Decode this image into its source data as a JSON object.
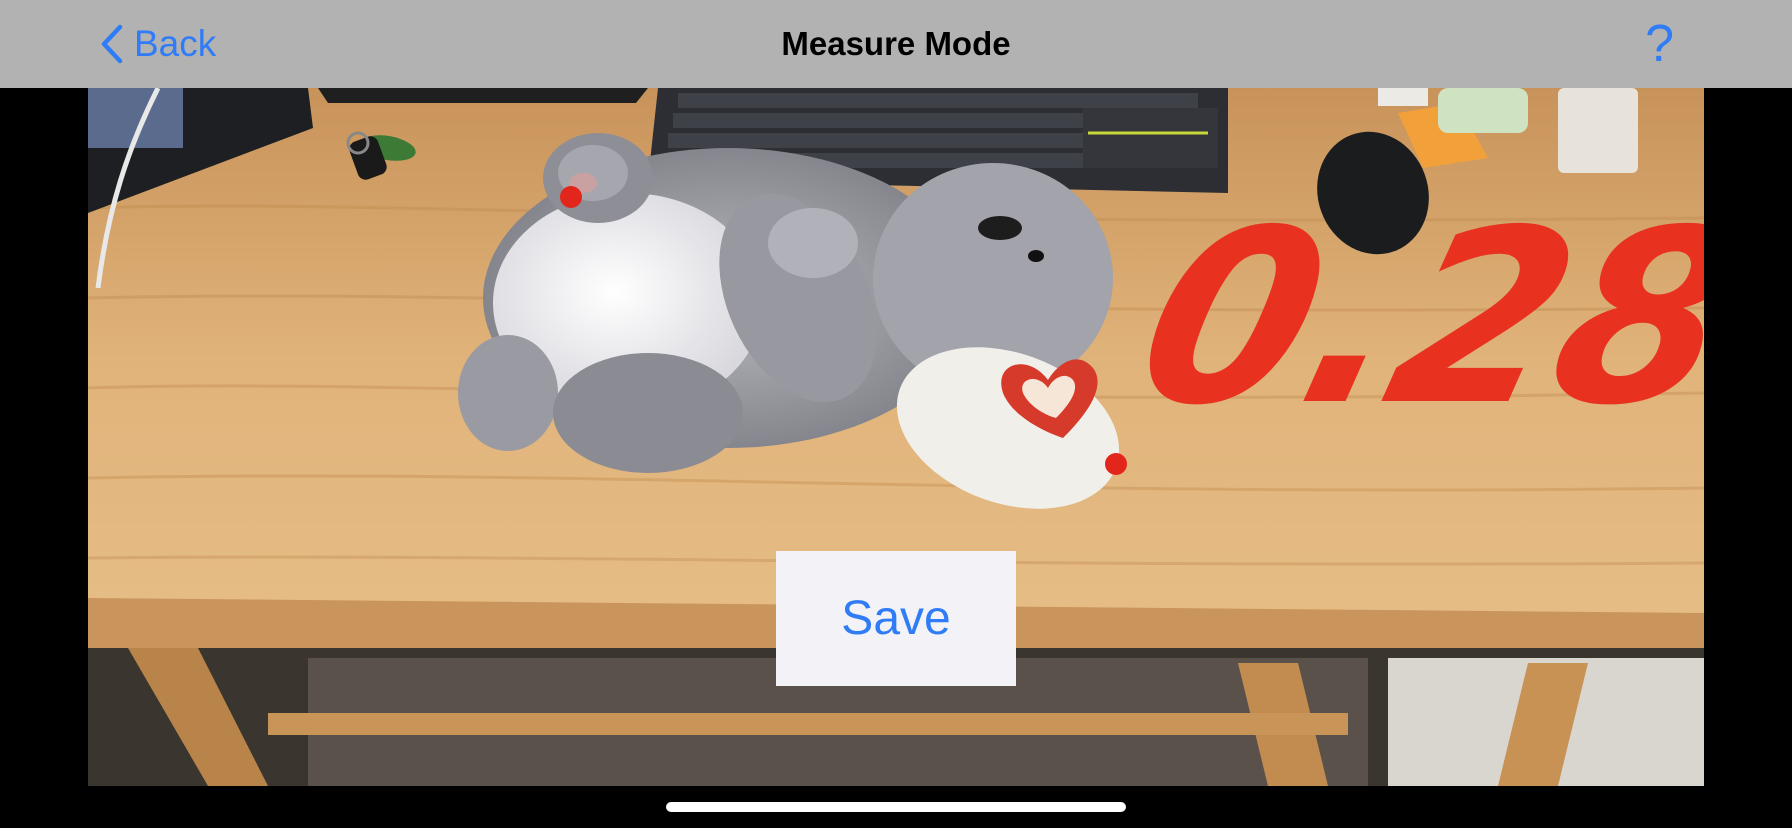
{
  "navbar": {
    "back_label": "Back",
    "title": "Measure Mode",
    "help_label": "?"
  },
  "measurement": {
    "value_text": "0.28"
  },
  "actions": {
    "save_label": "Save"
  },
  "colors": {
    "accent": "#2f7cf6",
    "navbar_bg": "#b2b2b2",
    "measure_red": "#e8321f"
  },
  "icons": {
    "back": "chevron-left-icon"
  }
}
